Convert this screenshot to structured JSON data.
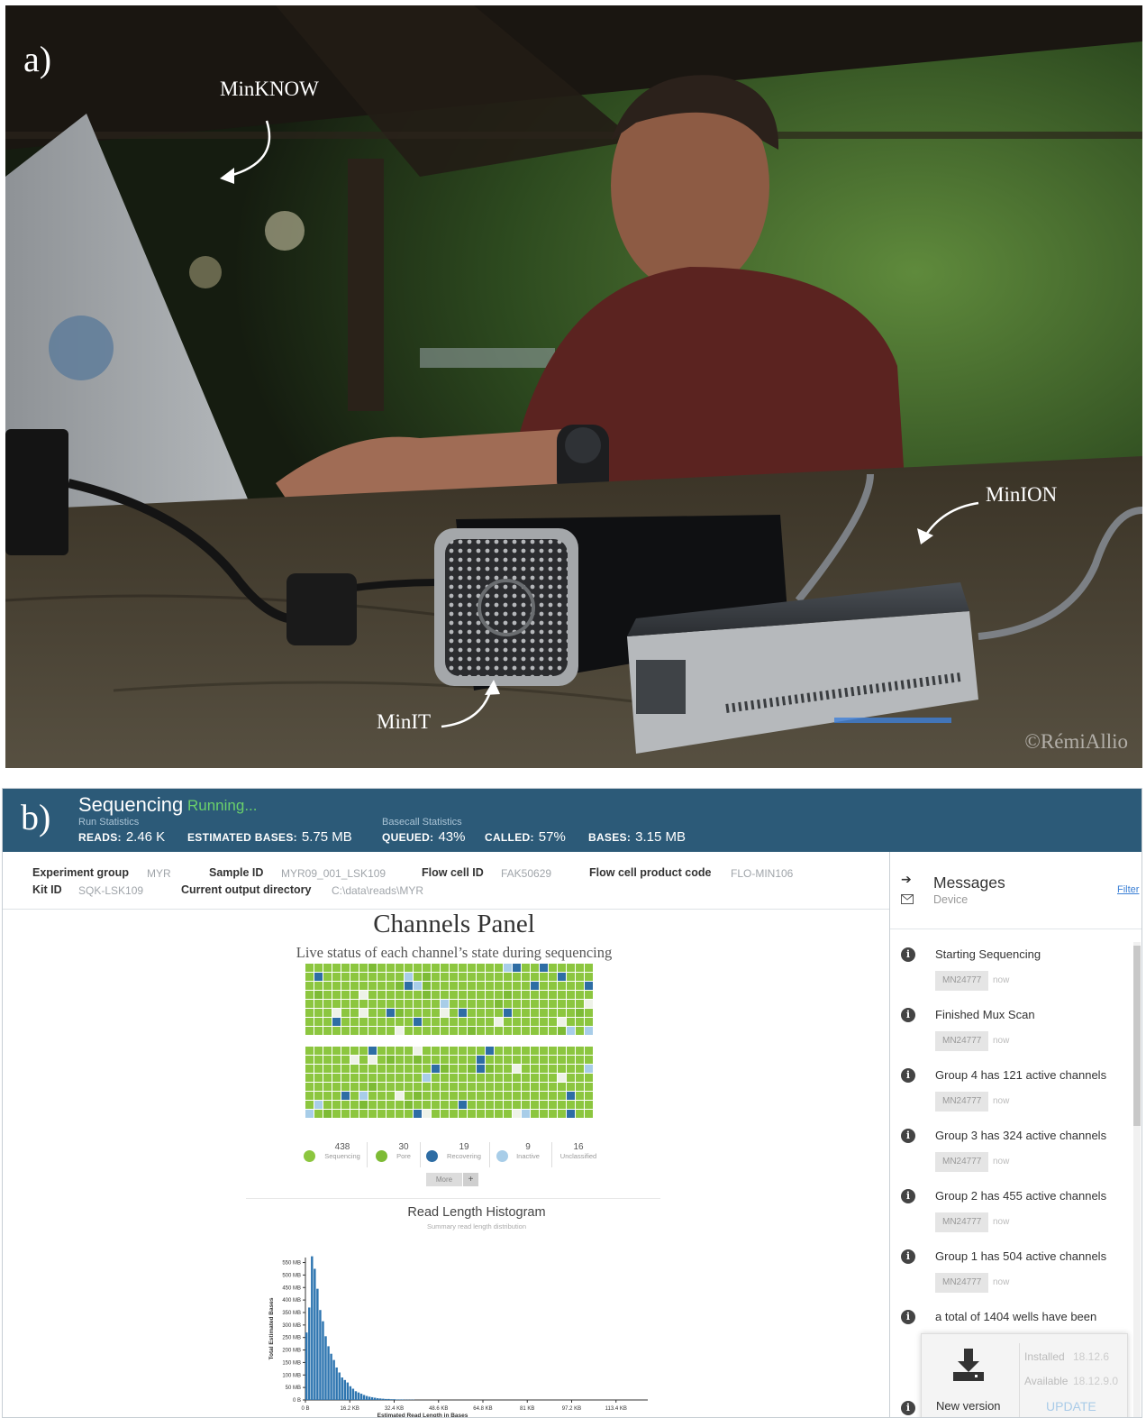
{
  "panel_a": {
    "label": "a)",
    "annotations": {
      "minknow": "MinKNOW",
      "minion": "MinION",
      "minit": "MinIT"
    },
    "copyright": "©RémiAllio"
  },
  "panel_b": {
    "label": "b)",
    "header": {
      "title": "Sequencing",
      "status": "Running...",
      "run_statistics": {
        "heading": "Run Statistics",
        "reads_label": "READS:",
        "reads_value": "2.46 K",
        "est_bases_label": "ESTIMATED BASES:",
        "est_bases_value": "5.75 MB"
      },
      "basecall_statistics": {
        "heading": "Basecall Statistics",
        "queued_label": "QUEUED:",
        "queued_value": "43%",
        "called_label": "CALLED:",
        "called_value": "57%",
        "bases_label": "BASES:",
        "bases_value": "3.15 MB"
      }
    },
    "info": {
      "experiment_group_label": "Experiment group",
      "experiment_group": "MYR",
      "sample_id_label": "Sample ID",
      "sample_id": "MYR09_001_LSK109",
      "flow_cell_id_label": "Flow cell ID",
      "flow_cell_id": "FAK50629",
      "flow_cell_product_label": "Flow cell product code",
      "flow_cell_product": "FLO-MIN106",
      "kit_id_label": "Kit ID",
      "kit_id": "SQK-LSK109",
      "output_dir_label": "Current output directory",
      "output_dir": "C:\\data\\reads\\MYR"
    },
    "channels_panel": {
      "title": "Channels Panel",
      "subtitle": "Live status of each channel’s state during sequencing",
      "colors": {
        "sequencing": "#8cc63f",
        "pore": "#7dbb35",
        "recovering": "#2e6da4",
        "inactive": "#a8cde8",
        "unclassified": "#eef2e8"
      },
      "legend": [
        {
          "count": "438",
          "name": "Sequencing"
        },
        {
          "count": "30",
          "name": "Pore"
        },
        {
          "count": "19",
          "name": "Recovering"
        },
        {
          "count": "9",
          "name": "Inactive"
        },
        {
          "count": "16",
          "name": "Unclassified"
        }
      ],
      "more_label": "More",
      "plus_label": "+"
    },
    "histogram": {
      "title": "Read Length Histogram",
      "subtitle": "Summary read length distribution"
    },
    "chart_data": {
      "type": "bar",
      "title": "Read Length Histogram",
      "subtitle": "Summary read length distribution",
      "xlabel": "Estimated Read Length in Bases",
      "ylabel": "Total Estimated Bases",
      "x_ticks": [
        "0 B",
        "16.2 KB",
        "32.4 KB",
        "48.6 KB",
        "64.8 KB",
        "81 KB",
        "97.2 KB",
        "113.4 KB"
      ],
      "x_tick_values_kb": [
        0,
        16.2,
        32.4,
        48.6,
        64.8,
        81,
        97.2,
        113.4
      ],
      "y_ticks": [
        "0 B",
        "50 MB",
        "100 MB",
        "150 MB",
        "200 MB",
        "250 MB",
        "300 MB",
        "350 MB",
        "400 MB",
        "450 MB",
        "500 MB",
        "550 MB"
      ],
      "ylim_mb": [
        0,
        570
      ],
      "xlim_kb": [
        0,
        125
      ],
      "bin_width_kb": 1,
      "values_mb": [
        270,
        370,
        575,
        525,
        445,
        360,
        315,
        255,
        215,
        185,
        160,
        130,
        110,
        90,
        80,
        70,
        55,
        45,
        35,
        30,
        25,
        20,
        16,
        13,
        11,
        9,
        7,
        6,
        5,
        4,
        4,
        3,
        3,
        2,
        2,
        2,
        1,
        1,
        1,
        1
      ],
      "bar_color": "#2e75b0"
    },
    "messages": {
      "title": "Messages",
      "subtitle": "Device",
      "filter": "Filter",
      "items": [
        {
          "text": "Starting Sequencing",
          "device": "MN24777",
          "time": "now"
        },
        {
          "text": "Finished Mux Scan",
          "device": "MN24777",
          "time": "now"
        },
        {
          "text": "Group 4 has 121 active channels",
          "device": "MN24777",
          "time": "now"
        },
        {
          "text": "Group 3 has 324 active channels",
          "device": "MN24777",
          "time": "now"
        },
        {
          "text": "Group 2 has 455 active channels",
          "device": "MN24777",
          "time": "now"
        },
        {
          "text": "Group 1 has 504 active channels",
          "device": "MN24777",
          "time": "now"
        },
        {
          "text": "a total of 1404 wells have been",
          "device": "",
          "time": ""
        }
      ],
      "update_card": {
        "label": "New version",
        "installed_label": "Installed",
        "installed": "18.12.6",
        "available_label": "Available",
        "available": "18.12.9.0",
        "button": "UPDATE"
      }
    }
  }
}
